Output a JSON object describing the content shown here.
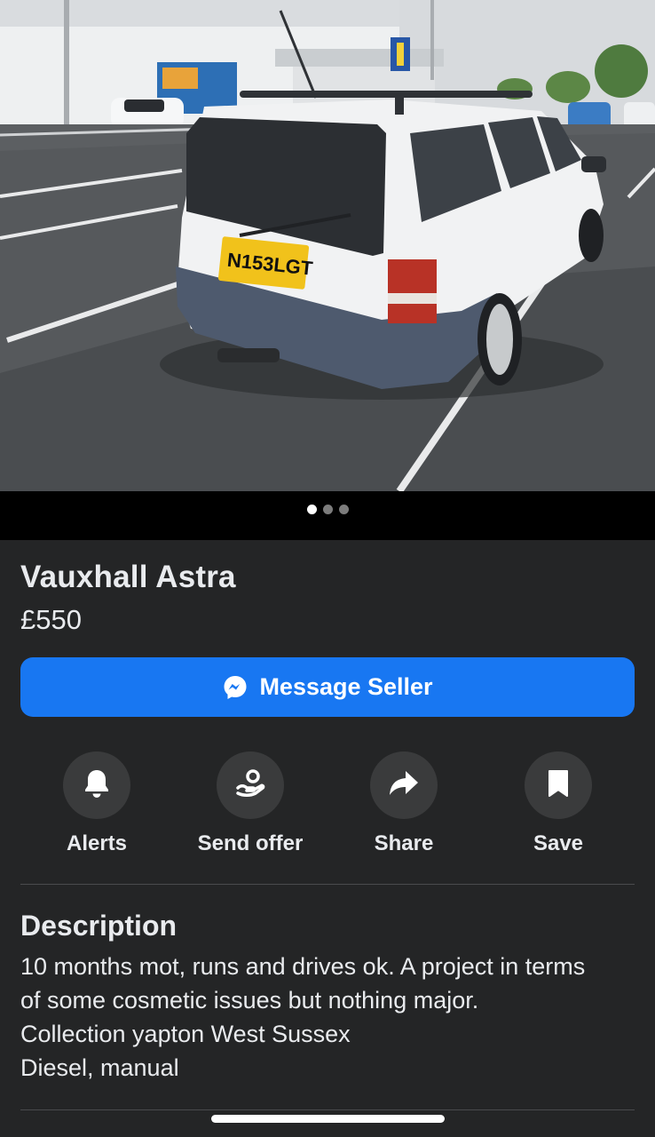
{
  "listing": {
    "title": "Vauxhall Astra",
    "price": "£550",
    "photo": {
      "image_count": 3,
      "active_index": 0,
      "plate_text": "N153LGT"
    }
  },
  "message_button": {
    "label": "Message Seller",
    "icon": "messenger-icon"
  },
  "actions": [
    {
      "label": "Alerts",
      "icon": "bell-icon"
    },
    {
      "label": "Send offer",
      "icon": "offer-hand-icon"
    },
    {
      "label": "Share",
      "icon": "share-arrow-icon"
    },
    {
      "label": "Save",
      "icon": "bookmark-icon"
    }
  ],
  "description": {
    "heading": "Description",
    "lines": [
      "10 months mot, runs and drives ok. A project in terms",
      "of some cosmetic issues but nothing major.",
      "Collection yapton West Sussex",
      "Diesel, manual"
    ]
  },
  "colors": {
    "background": "#242526",
    "accent": "#1877f2",
    "action_circle": "#3a3b3c"
  }
}
